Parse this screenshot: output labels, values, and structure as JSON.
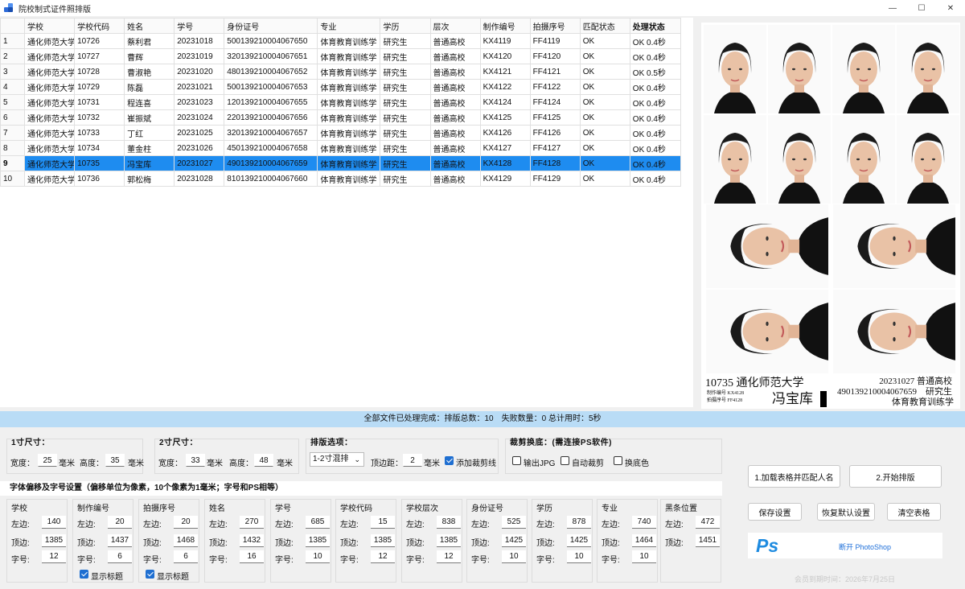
{
  "window": {
    "title": "院校制式证件照排版",
    "minimize": "—",
    "maximize": "☐",
    "close": "✕"
  },
  "table": {
    "headers": [
      "",
      "学校",
      "学校代码",
      "姓名",
      "学号",
      "身份证号",
      "专业",
      "学历",
      "层次",
      "制作编号",
      "拍摄序号",
      "匹配状态",
      "处理状态"
    ],
    "rows": [
      [
        "1",
        "通化师范大学",
        "10726",
        "蔡利君",
        "20231018",
        "500139210004067650",
        "体育教育训练学",
        "研究生",
        "普通高校",
        "KX4119",
        "FF4119",
        "OK",
        "OK 0.4秒"
      ],
      [
        "2",
        "通化师范大学",
        "10727",
        "曹辉",
        "20231019",
        "320139210004067651",
        "体育教育训练学",
        "研究生",
        "普通高校",
        "KX4120",
        "FF4120",
        "OK",
        "OK 0.4秒"
      ],
      [
        "3",
        "通化师范大学",
        "10728",
        "曹淑艳",
        "20231020",
        "480139210004067652",
        "体育教育训练学",
        "研究生",
        "普通高校",
        "KX4121",
        "FF4121",
        "OK",
        "OK 0.5秒"
      ],
      [
        "4",
        "通化师范大学",
        "10729",
        "陈磊",
        "20231021",
        "500139210004067653",
        "体育教育训练学",
        "研究生",
        "普通高校",
        "KX4122",
        "FF4122",
        "OK",
        "OK 0.4秒"
      ],
      [
        "5",
        "通化师范大学",
        "10731",
        "程连喜",
        "20231023",
        "120139210004067655",
        "体育教育训练学",
        "研究生",
        "普通高校",
        "KX4124",
        "FF4124",
        "OK",
        "OK 0.4秒"
      ],
      [
        "6",
        "通化师范大学",
        "10732",
        "崔振斌",
        "20231024",
        "220139210004067656",
        "体育教育训练学",
        "研究生",
        "普通高校",
        "KX4125",
        "FF4125",
        "OK",
        "OK 0.4秒"
      ],
      [
        "7",
        "通化师范大学",
        "10733",
        "丁红",
        "20231025",
        "320139210004067657",
        "体育教育训练学",
        "研究生",
        "普通高校",
        "KX4126",
        "FF4126",
        "OK",
        "OK 0.4秒"
      ],
      [
        "8",
        "通化师范大学",
        "10734",
        "董金柱",
        "20231026",
        "450139210004067658",
        "体育教育训练学",
        "研究生",
        "普通高校",
        "KX4127",
        "FF4127",
        "OK",
        "OK 0.4秒"
      ],
      [
        "9",
        "通化师范大学",
        "10735",
        "冯宝库",
        "20231027",
        "490139210004067659",
        "体育教育训练学",
        "研究生",
        "普通高校",
        "KX4128",
        "FF4128",
        "OK",
        "OK 0.4秒"
      ],
      [
        "10",
        "通化师范大学",
        "10736",
        "郭松梅",
        "20231028",
        "810139210004067660",
        "体育教育训练学",
        "研究生",
        "普通高校",
        "KX4129",
        "FF4129",
        "OK",
        "OK 0.4秒"
      ]
    ]
  },
  "preview": {
    "code_school": "10735 通化师范大学",
    "make_no": "制作编号 KX4128",
    "shot_no": "拍摄序号 FF4128",
    "name": "冯宝库",
    "right_line1": "20231027 普通高校",
    "right_line2": "490139210004067659　研究生",
    "right_line3": "体育教育训练学"
  },
  "status_text": "全部文件已处理完成：排版总数：10　失败数量：0 总计用时：5秒",
  "size1": {
    "title": "1寸尺寸：",
    "width_label": "宽度：",
    "width": "25",
    "height_label": "高度：",
    "height": "35",
    "unit": "毫米"
  },
  "size2": {
    "title": "2寸尺寸：",
    "width_label": "宽度：",
    "width": "33",
    "height_label": "高度：",
    "height": "48",
    "unit": "毫米"
  },
  "layout": {
    "title": "排版选项：",
    "mode": "1-2寸混排",
    "margin_label": "顶边距：",
    "margin": "2",
    "unit": "毫米",
    "cutline": "添加裁剪线"
  },
  "crop": {
    "title": "裁剪换底：(需连接PS软件)",
    "export_jpg": "输出JPG",
    "auto_crop": "自动裁剪",
    "change_bg": "换底色"
  },
  "font_section_title": "字体偏移及字号设置（偏移单位为像素，10个像素为1毫米；字号和PS相等）",
  "labels": {
    "left": "左边:",
    "top": "顶边:",
    "size": "字号:",
    "show_title": "显示标题"
  },
  "columns": [
    {
      "title": "学校",
      "left": "140",
      "top": "1385",
      "size": "12"
    },
    {
      "title": "制作编号",
      "left": "20",
      "top": "1437",
      "size": "6",
      "show_title": true
    },
    {
      "title": "拍摄序号",
      "left": "20",
      "top": "1468",
      "size": "6",
      "show_title": true
    },
    {
      "title": "姓名",
      "left": "270",
      "top": "1432",
      "size": "16"
    },
    {
      "title": "学号",
      "left": "685",
      "top": "1385",
      "size": "10"
    },
    {
      "title": "学校代码",
      "left": "15",
      "top": "1385",
      "size": "12"
    },
    {
      "title": "学校层次",
      "left": "838",
      "top": "1385",
      "size": "12"
    },
    {
      "title": "身份证号",
      "left": "525",
      "top": "1425",
      "size": "10"
    },
    {
      "title": "学历",
      "left": "878",
      "top": "1425",
      "size": "10"
    },
    {
      "title": "专业",
      "left": "740",
      "top": "1464",
      "size": "10"
    },
    {
      "title": "黑条位置",
      "left": "472",
      "top": "1451"
    }
  ],
  "buttons": {
    "load": "1.加载表格并匹配人名",
    "start": "2.开始排版",
    "save": "保存设置",
    "restore": "恢复默认设置",
    "clear": "清空表格"
  },
  "ps": {
    "logo": "Ps",
    "text": "断开 PhotoShop"
  },
  "member": "会员到期时间：2026年7月25日",
  "colors": {
    "selected_row": "#1e8cf0",
    "status_bar": "#b9dcf6",
    "ps_blue": "#1e8be0"
  }
}
